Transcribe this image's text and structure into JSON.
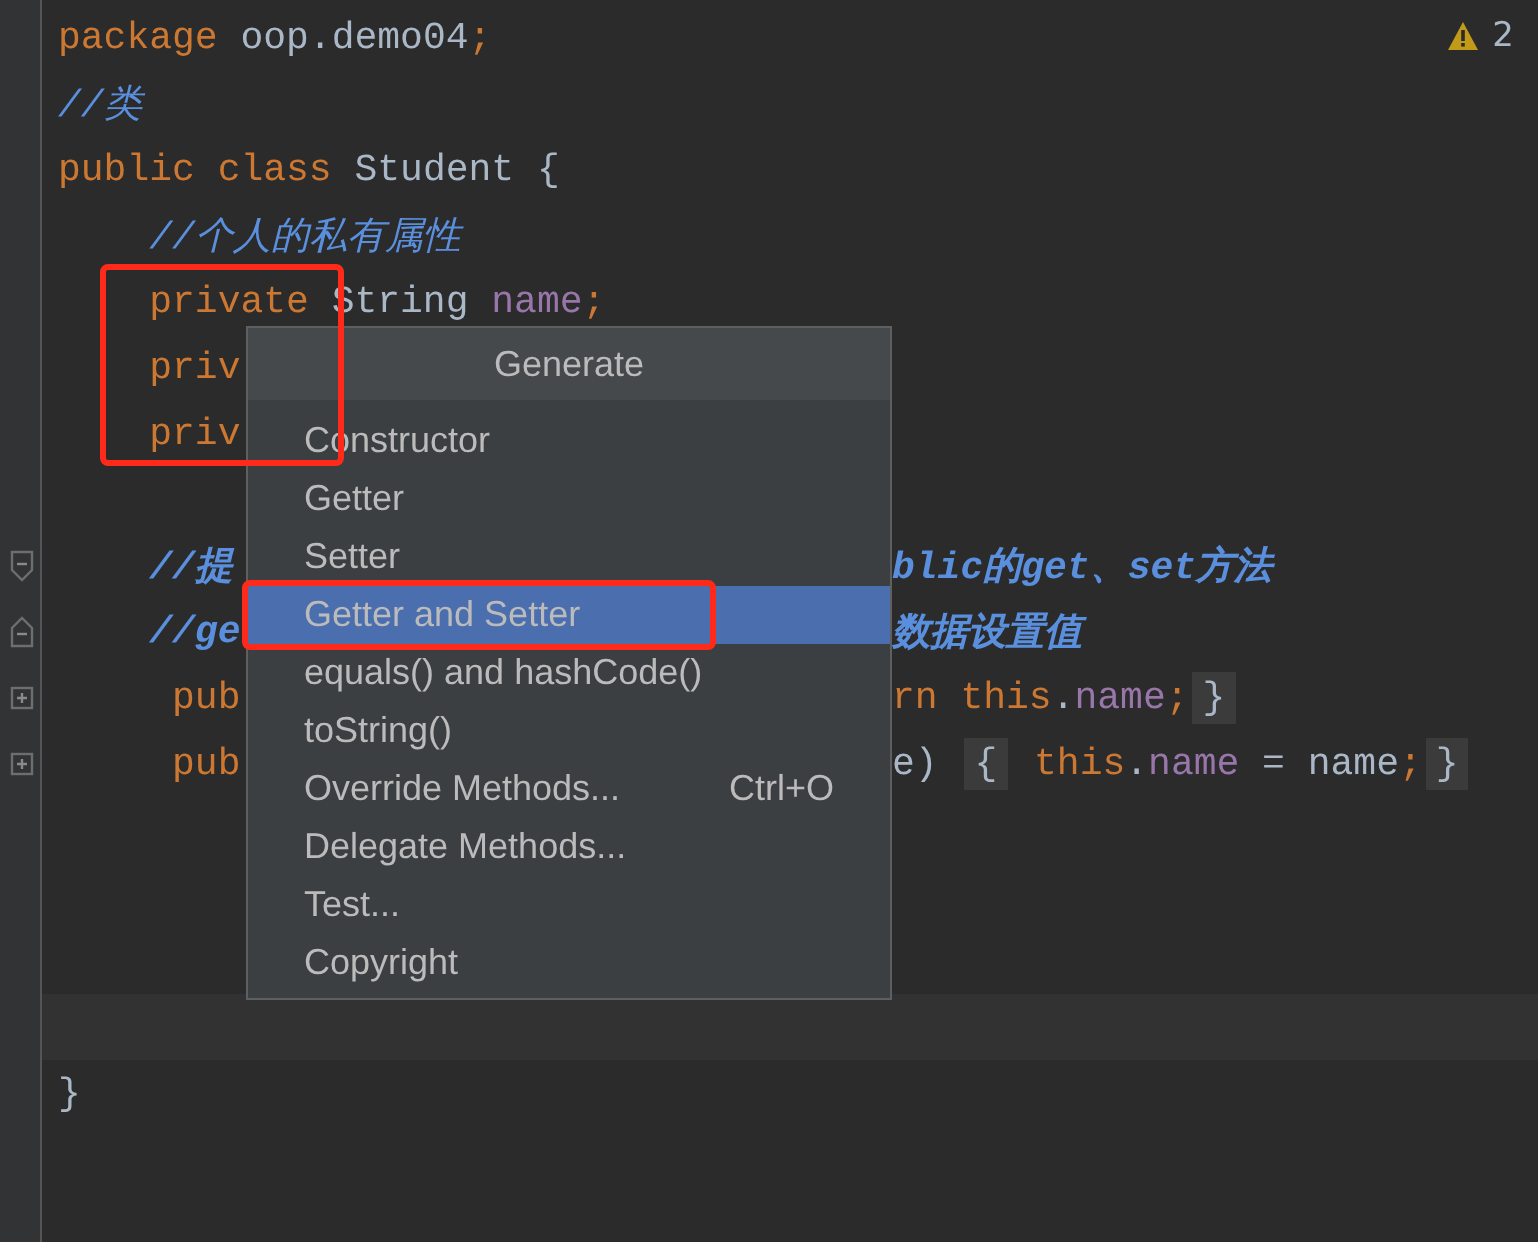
{
  "warnings": {
    "count": "2"
  },
  "lines": [
    {
      "current": false,
      "left": [
        {
          "kind": "keyword",
          "text": "package"
        },
        {
          "kind": "plain",
          "text": " oop.demo04"
        },
        {
          "kind": "keyword",
          "text": ";"
        }
      ]
    },
    {
      "current": false,
      "left": [
        {
          "kind": "comment",
          "text": "//类"
        }
      ]
    },
    {
      "current": false,
      "left": [
        {
          "kind": "keyword",
          "text": "public class "
        },
        {
          "kind": "plain",
          "text": "Student {"
        }
      ]
    },
    {
      "current": false,
      "left": [
        {
          "kind": "comment",
          "text": "    //个人的私有属性"
        }
      ]
    },
    {
      "current": false,
      "left": [
        {
          "kind": "keyword",
          "text": "    private"
        },
        {
          "kind": "plain",
          "text": " String "
        },
        {
          "kind": "field",
          "text": "name"
        },
        {
          "kind": "keyword",
          "text": ";"
        }
      ]
    },
    {
      "current": false,
      "left": [
        {
          "kind": "keyword",
          "text": "    priv"
        }
      ]
    },
    {
      "current": false,
      "left": [
        {
          "kind": "keyword",
          "text": "    priv"
        }
      ]
    },
    {
      "current": false
    },
    {
      "current": false,
      "fold": {
        "kind": "start"
      },
      "left": [
        {
          "kind": "comment_bold",
          "text": "    //提"
        }
      ],
      "right": [
        {
          "kind": "comment_bold",
          "text": "blic的get、set方法"
        }
      ]
    },
    {
      "current": false,
      "fold": {
        "kind": "end"
      },
      "left": [
        {
          "kind": "comment_bold",
          "text": "    //ge"
        }
      ],
      "right": [
        {
          "kind": "comment_bold",
          "text": "数据设置值"
        }
      ]
    },
    {
      "current": false,
      "fold": {
        "kind": "collapsed"
      },
      "left": [
        {
          "kind": "keyword",
          "text": "     pub"
        }
      ],
      "right": [
        {
          "kind": "keyword",
          "text": "rn this"
        },
        {
          "kind": "plain",
          "text": "."
        },
        {
          "kind": "field",
          "text": "name"
        },
        {
          "kind": "keyword",
          "text": ";"
        },
        {
          "kind": "folded",
          "text": "}"
        }
      ]
    },
    {
      "current": false,
      "fold": {
        "kind": "collapsed"
      },
      "left": [
        {
          "kind": "keyword",
          "text": "     pub"
        }
      ],
      "right": [
        {
          "kind": "plain",
          "text": "e) "
        },
        {
          "kind": "folded",
          "text": "{"
        },
        {
          "kind": "keyword",
          "text": " this"
        },
        {
          "kind": "plain",
          "text": "."
        },
        {
          "kind": "field",
          "text": "name"
        },
        {
          "kind": "plain",
          "text": " = name"
        },
        {
          "kind": "keyword",
          "text": ";"
        },
        {
          "kind": "folded",
          "text": "}"
        }
      ]
    },
    {
      "current": false
    },
    {
      "current": false
    },
    {
      "current": false
    },
    {
      "current": true
    },
    {
      "current": false,
      "left": [
        {
          "kind": "plain",
          "text": "}"
        }
      ]
    }
  ],
  "popup": {
    "title": "Generate",
    "items": [
      {
        "label": "Constructor",
        "selected": false
      },
      {
        "label": "Getter",
        "selected": false
      },
      {
        "label": "Setter",
        "selected": false
      },
      {
        "label": "Getter and Setter",
        "selected": true
      },
      {
        "label": "equals() and hashCode()",
        "selected": false
      },
      {
        "label": "toString()",
        "selected": false
      },
      {
        "label": "Override Methods...",
        "shortcut": "Ctrl+O",
        "selected": false
      },
      {
        "label": "Delegate Methods...",
        "selected": false
      },
      {
        "label": "Test...",
        "selected": false
      },
      {
        "label": "Copyright",
        "selected": false
      }
    ]
  }
}
